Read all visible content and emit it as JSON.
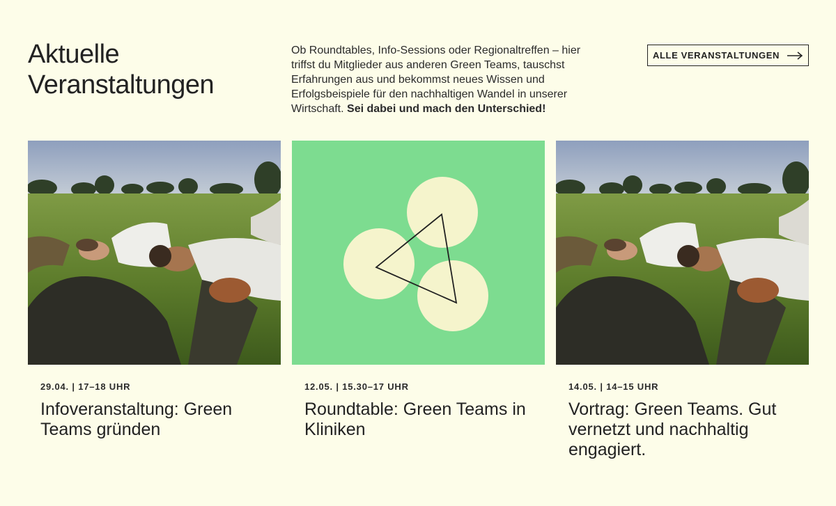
{
  "header": {
    "title_line1": "Aktuelle",
    "title_line2": "Veranstaltungen",
    "intro_text": "Ob Roundtables, Info-Sessions oder Regionaltreffen – hier triffst du Mitglieder aus anderen Green Teams, tauschst Erfahrungen aus und bekommst neues Wissen und Erfolgsbeispiele für den nachhaltigen Wandel in unserer Wirtschaft.",
    "intro_emphasis": "Sei dabei und mach den Unterschied!",
    "cta_label": "ALLE VERANSTALTUNGEN",
    "cta_icon": "arrow-right-icon"
  },
  "events": [
    {
      "date": "29.04. | 17–18 UHR",
      "title": "Infoveranstaltung: Green Teams gründen",
      "image": "photo-people-lying-in-grass"
    },
    {
      "date": "12.05. | 15.30–17 UHR",
      "title": "Roundtable: Green Teams in Kliniken",
      "image": "illustration-three-circles-triangle"
    },
    {
      "date": "14.05. | 14–15 UHR",
      "title": "Vortrag: Green Teams. Gut vernetzt und nachhaltig engagiert.",
      "image": "photo-people-lying-in-grass"
    }
  ],
  "colors": {
    "background": "#fdfde9",
    "text": "#222222",
    "illustration_green": "#7ddc90",
    "illustration_cream": "#f5f4cc"
  }
}
